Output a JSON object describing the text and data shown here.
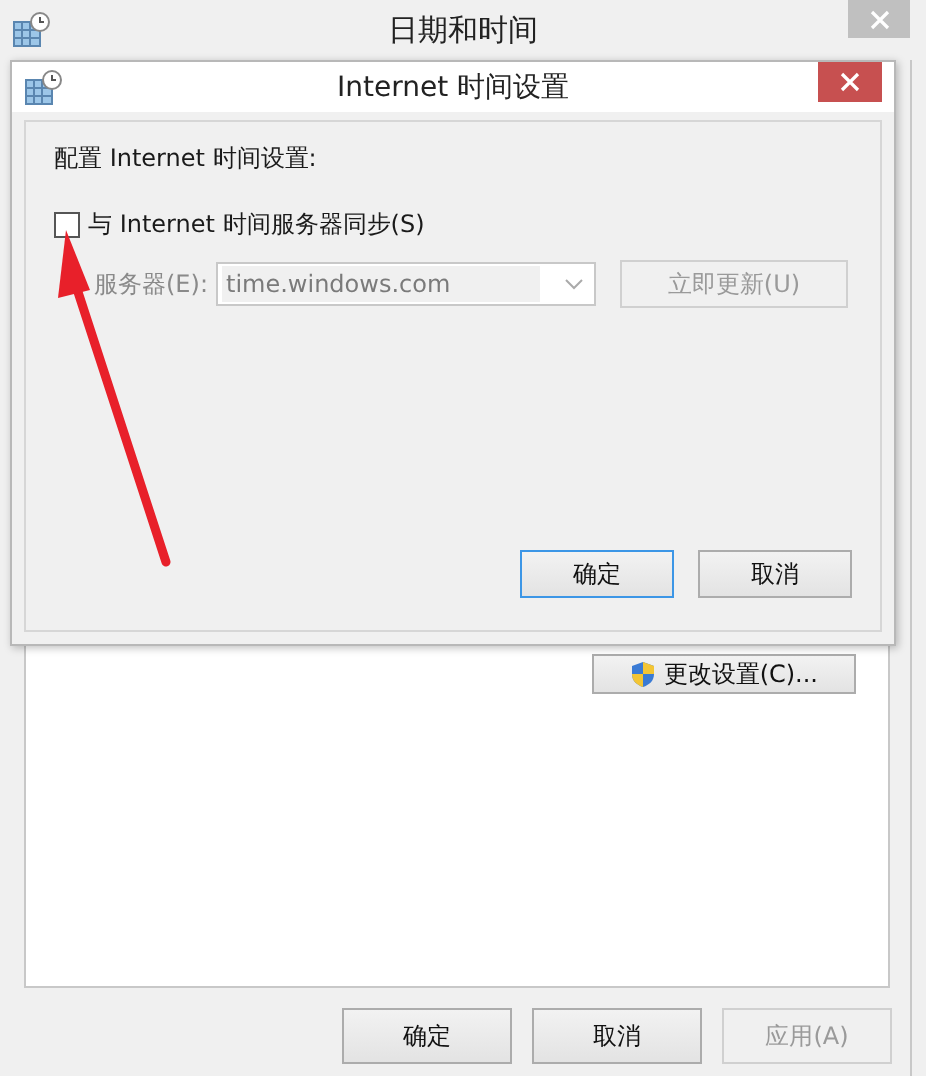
{
  "window": {
    "title": "日期和时间",
    "change_settings_button": "更改设置(C)...",
    "buttons": [
      {
        "label": "确定",
        "disabled": false
      },
      {
        "label": "取消",
        "disabled": false
      },
      {
        "label": "应用(A)",
        "disabled": true
      }
    ]
  },
  "dialog": {
    "title": "Internet 时间设置",
    "heading": "配置 Internet 时间设置:",
    "sync_checkbox": {
      "label": "与 Internet 时间服务器同步(S)",
      "checked": false
    },
    "server": {
      "label": "服务器(E):",
      "value": "time.windows.com",
      "disabled": true
    },
    "update_button": {
      "label": "立即更新(U)",
      "disabled": true
    },
    "buttons": [
      {
        "label": "确定",
        "default": true
      },
      {
        "label": "取消",
        "default": false
      }
    ]
  }
}
